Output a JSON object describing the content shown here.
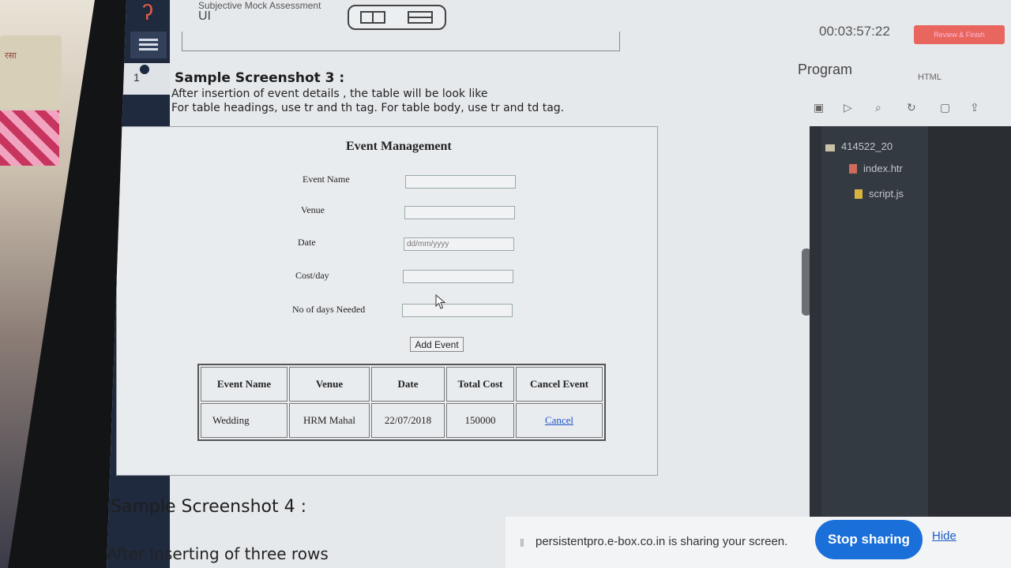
{
  "header": {
    "assessment_title": "Subjective Mock Assessment",
    "section": "UI",
    "timer": "00:03:57:22",
    "review_button": "Review & Finish"
  },
  "sidebar": {
    "question_number": "1"
  },
  "question": {
    "heading": "Sample Screenshot 3 :",
    "line1": "After insertion of event details , the table will be look like",
    "line2": "For table headings, use tr and th tag. For table body, use tr and td tag."
  },
  "sample": {
    "title": "Event Management",
    "form": {
      "event_name_label": "Event Name",
      "venue_label": "Venue",
      "date_label": "Date",
      "date_placeholder": "dd/mm/yyyy",
      "cost_label": "Cost/day",
      "days_label": "No of days Needed",
      "add_button": "Add Event"
    },
    "table": {
      "headers": [
        "Event Name",
        "Venue",
        "Date",
        "Total Cost",
        "Cancel Event"
      ],
      "rows": [
        [
          "Wedding",
          "HRM Mahal",
          "22/07/2018",
          "150000",
          "Cancel"
        ]
      ]
    }
  },
  "next": {
    "heading": "Sample Screenshot 4 :",
    "text": "After Inserting of three rows"
  },
  "program_panel": {
    "title": "Program",
    "language": "HTML",
    "folder": "414522_20",
    "files": [
      "index.htr",
      "script.js"
    ]
  },
  "share_notice": {
    "text": "persistentpro.e-box.co.in is sharing your screen.",
    "stop_button": "Stop sharing",
    "hide_link": "Hide"
  },
  "colors": {
    "accent_button": "#e8665d",
    "share_button": "#1a6fd8",
    "rail": "#1f2a3f"
  }
}
